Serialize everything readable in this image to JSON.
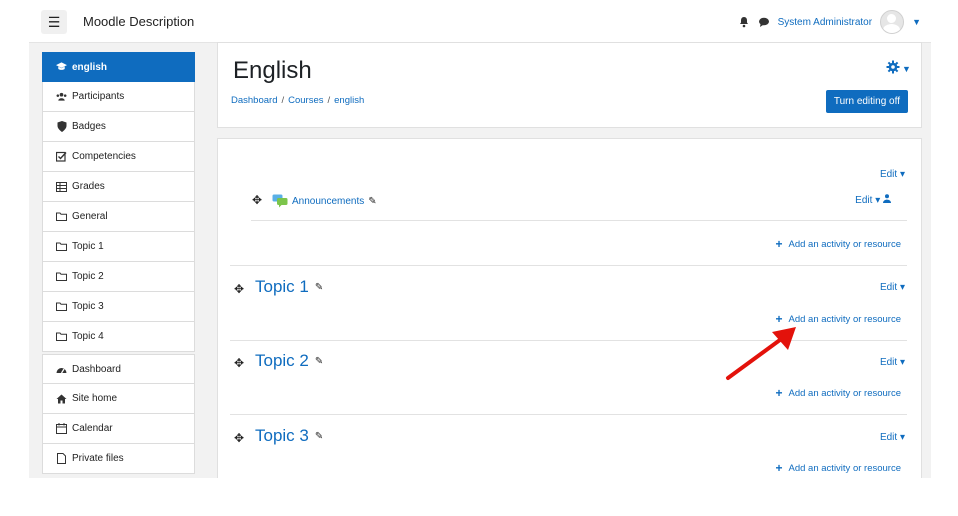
{
  "navbar": {
    "menu_icon": "☰",
    "site_name": "Moodle Description",
    "user_name": "System Administrator",
    "icons": [
      "bell-icon",
      "chat-icon",
      "avatar",
      "caret-down-icon"
    ]
  },
  "sidebar": {
    "items": [
      {
        "label": "english",
        "icon": "graduation-cap-icon",
        "active": true
      },
      {
        "label": "Participants",
        "icon": "users-icon"
      },
      {
        "label": "Badges",
        "icon": "shield-icon"
      },
      {
        "label": "Competencies",
        "icon": "checkbox-icon"
      },
      {
        "label": "Grades",
        "icon": "table-icon"
      },
      {
        "label": "General",
        "icon": "folder-icon"
      },
      {
        "label": "Topic 1",
        "icon": "folder-icon"
      },
      {
        "label": "Topic 2",
        "icon": "folder-icon"
      },
      {
        "label": "Topic 3",
        "icon": "folder-icon"
      },
      {
        "label": "Topic 4",
        "icon": "folder-icon"
      },
      {
        "label": "Dashboard",
        "icon": "dashboard-icon"
      },
      {
        "label": "Site home",
        "icon": "home-icon"
      },
      {
        "label": "Calendar",
        "icon": "calendar-icon"
      },
      {
        "label": "Private files",
        "icon": "file-icon"
      }
    ]
  },
  "header": {
    "title": "English",
    "breadcrumb": [
      "Dashboard",
      "Courses",
      "english"
    ],
    "breadcrumb_sep": "/",
    "edit_button": "Turn editing off"
  },
  "content": {
    "edit_label": "Edit",
    "add_label": "Add an activity or resource",
    "general": {
      "activity": "Announcements"
    },
    "topics": [
      {
        "title": "Topic 1"
      },
      {
        "title": "Topic 2"
      },
      {
        "title": "Topic 3"
      }
    ]
  },
  "colors": {
    "accent": "#0f6cbf",
    "annotation_arrow": "#e3120b"
  }
}
